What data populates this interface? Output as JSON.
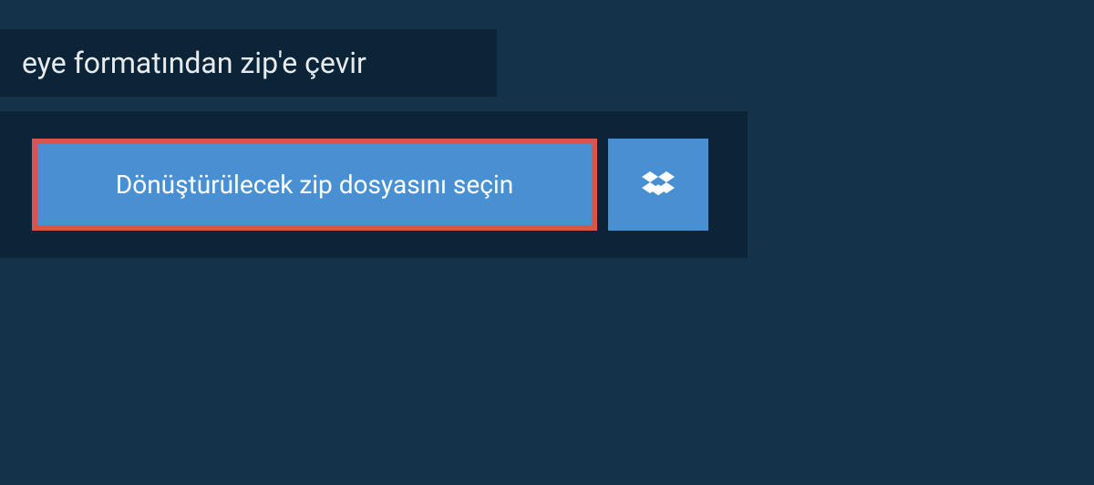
{
  "header": {
    "title": "eye formatından zip'e çevir"
  },
  "main": {
    "select_button_label": "Dönüştürülecek zip dosyasını seçin"
  }
}
